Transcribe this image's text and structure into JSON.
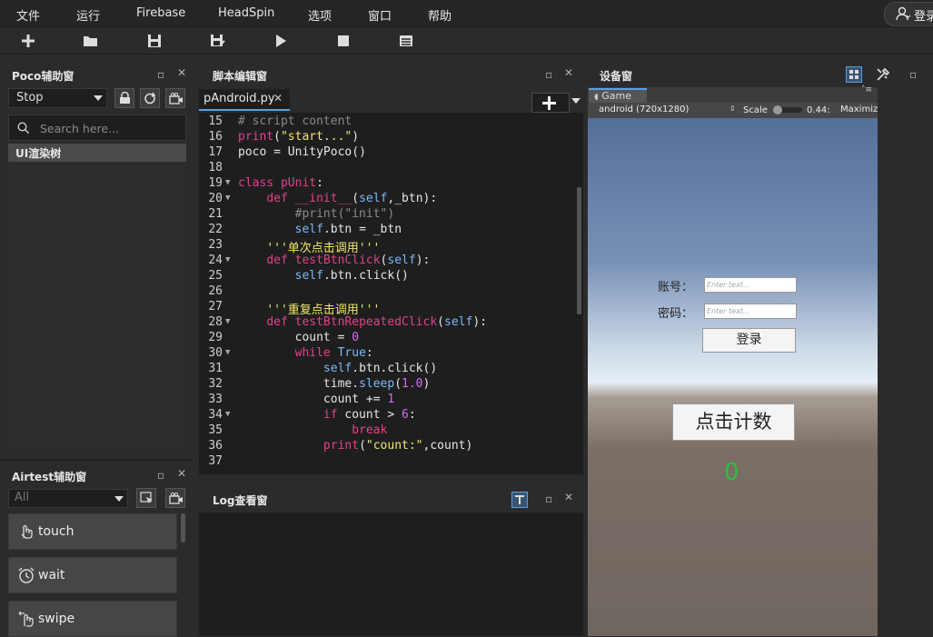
{
  "menu": [
    "文件",
    "运行",
    "Firebase",
    "HeadSpin",
    "选项",
    "窗口",
    "帮助"
  ],
  "login_label": "登录",
  "toolbar": [
    "plus-icon",
    "folder-open-icon",
    "save-icon",
    "save-as-icon",
    "play-icon",
    "stop-icon",
    "log-list-icon"
  ],
  "poco": {
    "title": "Poco辅助窗",
    "mode": "Stop",
    "search_placeholder": "Search here...",
    "tree_root": "UI渲染树"
  },
  "airtest": {
    "title": "Airtest辅助窗",
    "filter": "All",
    "commands": [
      "touch",
      "wait",
      "swipe"
    ]
  },
  "editor": {
    "title": "脚本编辑窗",
    "tab": "pAndroid.py",
    "lines": [
      {
        "n": "15",
        "fold": false,
        "code": "# script content"
      },
      {
        "n": "16",
        "fold": false,
        "code": "print(\"start...\")"
      },
      {
        "n": "17",
        "fold": false,
        "code": "poco = UnityPoco()"
      },
      {
        "n": "18",
        "fold": false,
        "code": ""
      },
      {
        "n": "19",
        "fold": true,
        "code": "class pUnit:"
      },
      {
        "n": "20",
        "fold": true,
        "code": "    def __init__(self,_btn):"
      },
      {
        "n": "21",
        "fold": false,
        "code": "        #print(\"init\")"
      },
      {
        "n": "22",
        "fold": false,
        "code": "        self.btn = _btn"
      },
      {
        "n": "23",
        "fold": false,
        "code": "    '''单次点击调用'''"
      },
      {
        "n": "24",
        "fold": true,
        "code": "    def testBtnClick(self):"
      },
      {
        "n": "25",
        "fold": false,
        "code": "        self.btn.click()"
      },
      {
        "n": "26",
        "fold": false,
        "code": ""
      },
      {
        "n": "27",
        "fold": false,
        "code": "    '''重复点击调用'''"
      },
      {
        "n": "28",
        "fold": true,
        "code": "    def testBtnRepeatedClick(self):"
      },
      {
        "n": "29",
        "fold": false,
        "code": "        count = 0"
      },
      {
        "n": "30",
        "fold": true,
        "code": "        while True:"
      },
      {
        "n": "31",
        "fold": false,
        "code": "            self.btn.click()"
      },
      {
        "n": "32",
        "fold": false,
        "code": "            time.sleep(1.0)"
      },
      {
        "n": "33",
        "fold": false,
        "code": "            count += 1"
      },
      {
        "n": "34",
        "fold": true,
        "code": "            if count > 6:"
      },
      {
        "n": "35",
        "fold": false,
        "code": "                break"
      },
      {
        "n": "36",
        "fold": false,
        "code": "            print(\"count:\",count)"
      },
      {
        "n": "37",
        "fold": false,
        "code": ""
      }
    ]
  },
  "log": {
    "title": "Log查看窗"
  },
  "device": {
    "title": "设备窗",
    "game_tab": "Game",
    "resolution": "android (720x1280)",
    "scale_label": "Scale",
    "scale_value": "0.44:",
    "maximize": "Maximiz",
    "account_label": "账号：",
    "password_label": "密码：",
    "input_placeholder": "Enter text...",
    "login_button": "登录",
    "count_button": "点击计数",
    "count_value": "0"
  },
  "colors": {
    "keyword": "#e0428b",
    "string": "#f2e86d",
    "comment": "#8a8a8a",
    "number": "#d56cf0",
    "builtin": "#7fb8f7",
    "accent": "#5aa0e0"
  }
}
